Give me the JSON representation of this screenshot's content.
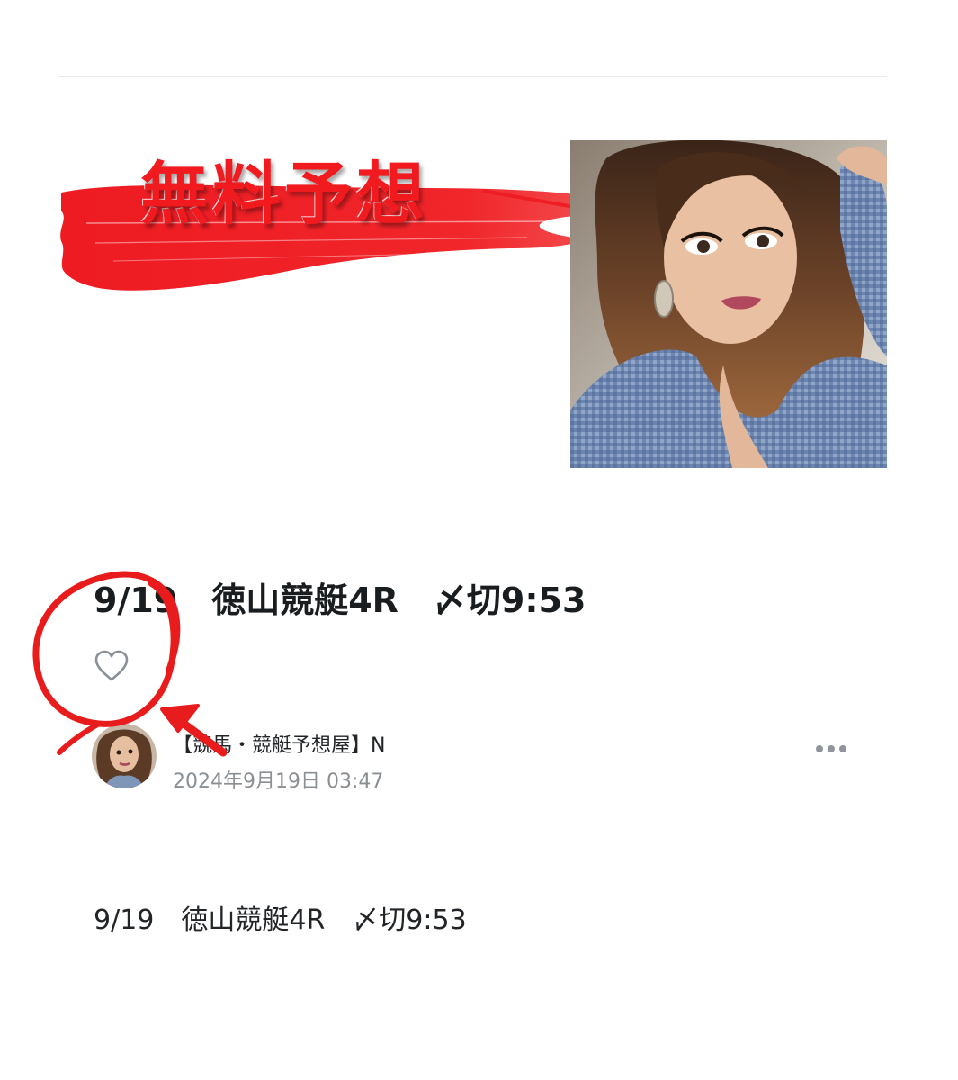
{
  "header_image": {
    "banner_text": "無料予想",
    "accent_color": "#f01a1f"
  },
  "post": {
    "title": "9/19　徳山競艇4R　〆切9:53",
    "like_icon": "heart-outline-icon",
    "author": {
      "name": "【競馬・競艇予想屋】N",
      "avatar": "author-avatar"
    },
    "date": "2024年9月19日 03:47",
    "more_icon": "more-dots-icon",
    "body": "9/19　徳山競艇4R　〆切9:53"
  },
  "annotation": {
    "color": "#e81c1c",
    "shapes": [
      "circle-annotation",
      "arrow-annotation"
    ]
  }
}
